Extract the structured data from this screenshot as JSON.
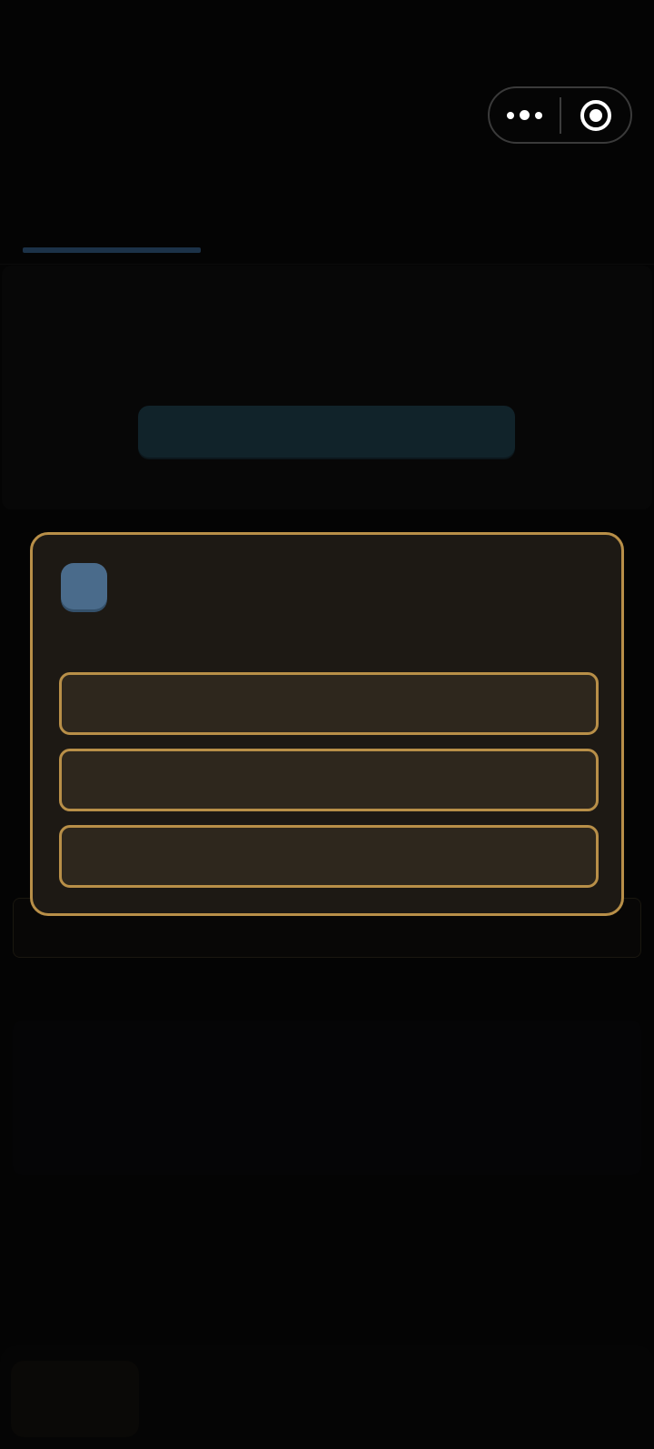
{
  "capsule": {
    "more_icon": "more-dots-icon",
    "close_icon": "target-circle-icon"
  },
  "header": {
    "tabs": []
  },
  "hero": {
    "button_label": ""
  },
  "modal": {
    "icon": "app-badge-icon",
    "options": [
      {
        "label": ""
      },
      {
        "label": ""
      },
      {
        "label": ""
      }
    ]
  },
  "footer": {
    "button_label": ""
  },
  "colors": {
    "accent_gold": "#b88f48",
    "modal_bg": "#1d1914",
    "option_bg": "#2e271d",
    "icon_blue": "#4a6b8b",
    "hero_button": "#11232a",
    "tab_indicator": "#1c3248"
  }
}
